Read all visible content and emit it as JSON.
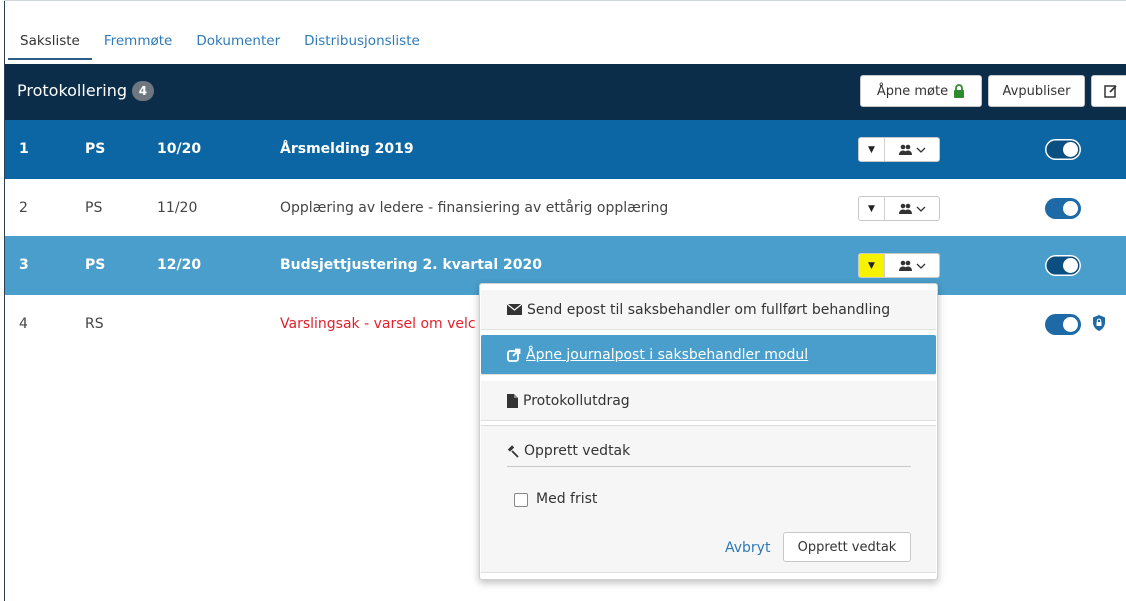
{
  "tabs": [
    {
      "label": "Saksliste",
      "active": true
    },
    {
      "label": "Fremmøte"
    },
    {
      "label": "Dokumenter"
    },
    {
      "label": "Distribusjonsliste"
    }
  ],
  "header": {
    "title": "Protokollering",
    "count": "4",
    "open_meeting_label": "Åpne møte",
    "unpublish_label": "Avpubliser"
  },
  "rows": [
    {
      "num": "1",
      "type": "PS",
      "case_nr": "10/20",
      "title": "Årsmelding 2019"
    },
    {
      "num": "2",
      "type": "PS",
      "case_nr": "11/20",
      "title": "Opplæring av ledere - finansiering av ettårig opplæring"
    },
    {
      "num": "3",
      "type": "PS",
      "case_nr": "12/20",
      "title": "Budsjettjustering 2. kvartal 2020"
    },
    {
      "num": "4",
      "type": "RS",
      "case_nr": "",
      "title": "Varslingsak - varsel om velc"
    }
  ],
  "menu": {
    "send_email": "Send epost til saksbehandler om fullført behandling",
    "open_journal": "Åpne journalpost i saksbehandler modul",
    "protocol_extract": "Protokollutdrag",
    "create_decision_title": "Opprett vedtak",
    "with_deadline": "Med frist",
    "cancel": "Avbryt",
    "create_decision_button": "Opprett vedtak"
  },
  "colors": {
    "header_bg": "#0b2d4a",
    "selected_row": "#0b66a3",
    "hover_row": "#4a9ecb",
    "warning_text": "#e2202c",
    "highlight_caret": "#f6f200"
  }
}
